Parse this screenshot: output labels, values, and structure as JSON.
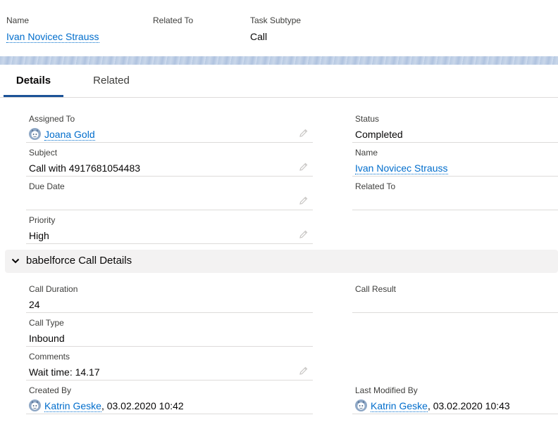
{
  "highlights": {
    "name_label": "Name",
    "name_value": "Ivan Novicec Strauss",
    "related_label": "Related To",
    "subtype_label": "Task Subtype",
    "subtype_value": "Call"
  },
  "tabs": {
    "details": "Details",
    "related": "Related"
  },
  "details": {
    "assigned_to_label": "Assigned To",
    "assigned_to_value": "Joana Gold",
    "status_label": "Status",
    "status_value": "Completed",
    "subject_label": "Subject",
    "subject_value": "Call with 4917681054483",
    "name_label": "Name",
    "name_value": "Ivan Novicec Strauss",
    "due_date_label": "Due Date",
    "related_label": "Related To",
    "priority_label": "Priority",
    "priority_value": "High"
  },
  "section": {
    "title": "babelforce Call Details",
    "call_duration_label": "Call Duration",
    "call_duration_value": "24",
    "call_result_label": "Call Result",
    "call_type_label": "Call Type",
    "call_type_value": "Inbound",
    "comments_label": "Comments",
    "comments_value": "Wait time: 14.17",
    "created_by_label": "Created By",
    "created_by_name": "Katrin Geske",
    "created_by_date": ", 03.02.2020 10:42",
    "last_modified_label": "Last Modified By",
    "last_modified_name": "Katrin Geske",
    "last_modified_date": ", 03.02.2020 10:43"
  },
  "colors": {
    "link": "#006dcc",
    "tab_active": "#1b5297",
    "section_bg": "#f3f2f2"
  }
}
